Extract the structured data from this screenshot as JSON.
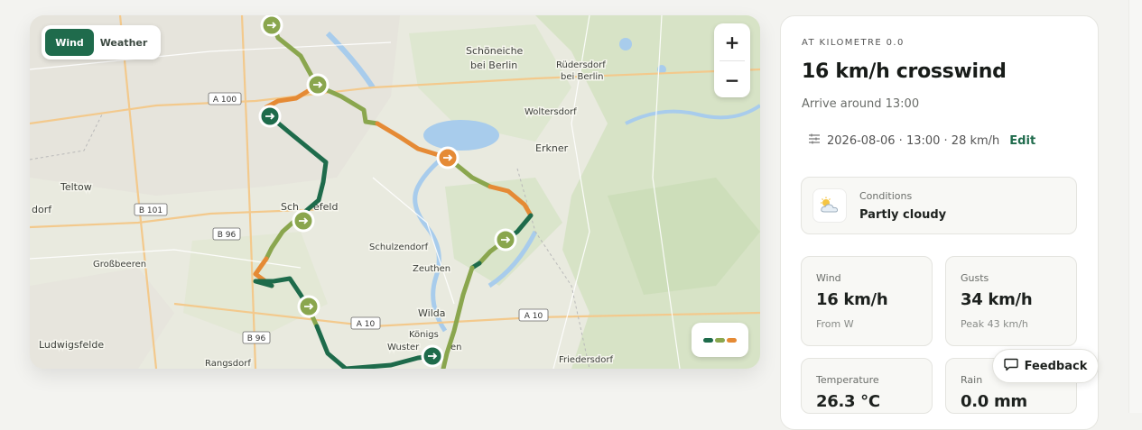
{
  "map": {
    "toggle": {
      "wind_label": "Wind",
      "weather_label": "Weather"
    },
    "zoom": {
      "in_label": "+",
      "out_label": "−"
    },
    "places": [
      "Schöneiche",
      "bei Berlin",
      "Rüdersdorf",
      "bei Berlin",
      "Woltersdorf",
      "Erkner",
      "Teltow",
      "dorf",
      "Sch",
      "efeld",
      "Schulzendorf",
      "Zeuthen",
      "Großbeeren",
      "Wilda",
      "Königs",
      "Wuster",
      "en",
      "Ludwigsfelde",
      "Rangsdorf",
      "Friedersdorf"
    ],
    "road_shields": [
      "A 100",
      "B 101",
      "B 96",
      "A 10",
      "B 96",
      "A 10"
    ],
    "route_colors": {
      "tailwind": "#1e6b4b",
      "crosswind": "#8aa64e",
      "headwind": "#e58a35"
    },
    "marker_icon": "arrow-right-icon"
  },
  "panel": {
    "eyebrow": "AT KILOMETRE 0.0",
    "headline": "16 km/h crosswind",
    "arrive": "Arrive around 13:00",
    "settings_text": "2026-08-06 · 13:00 · 28 km/h",
    "edit_label": "Edit",
    "conditions": {
      "label": "Conditions",
      "value": "Partly cloudy",
      "icon": "partly-cloudy-icon"
    },
    "stats": [
      {
        "label": "Wind",
        "value": "16 km/h",
        "sub": "From W"
      },
      {
        "label": "Gusts",
        "value": "34 km/h",
        "sub": "Peak 43 km/h"
      },
      {
        "label": "Temperature",
        "value": "26.3 °C",
        "sub": ""
      },
      {
        "label": "Rain",
        "value": "0.0 mm",
        "sub": ""
      }
    ]
  },
  "feedback_label": "Feedback"
}
